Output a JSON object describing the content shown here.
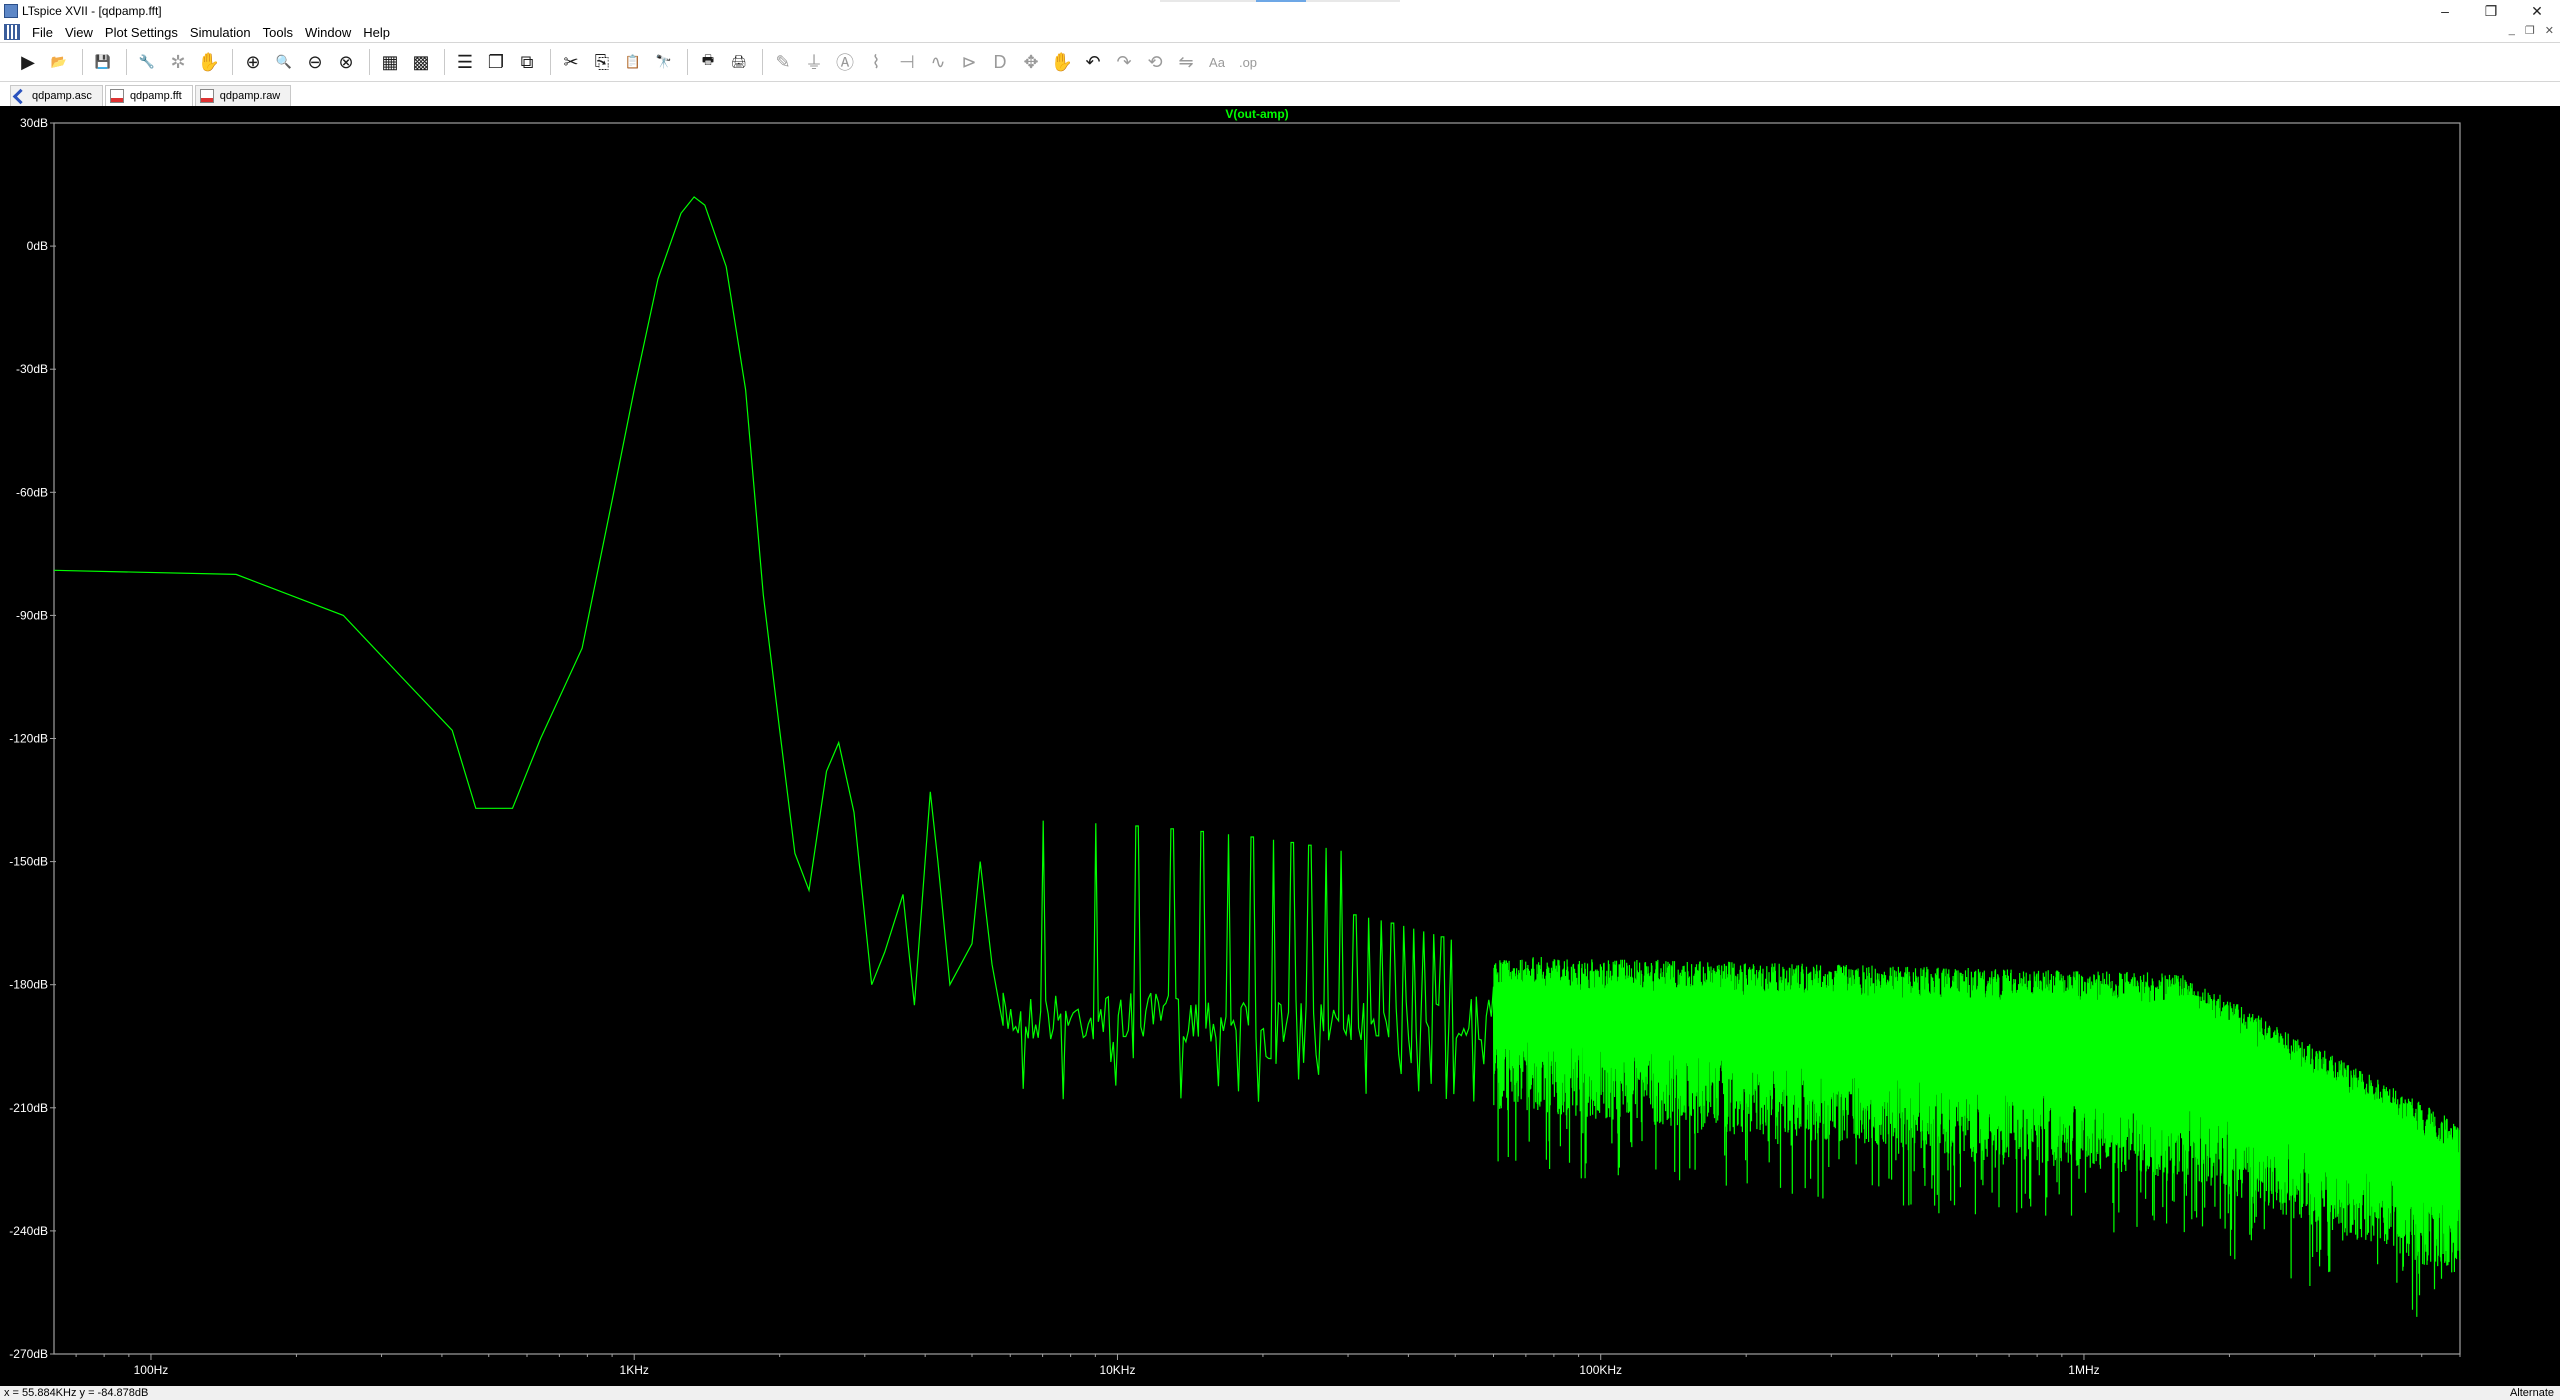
{
  "window": {
    "title": "LTspice XVII - [qdpamp.fft]",
    "controls": {
      "minimize": "–",
      "restore": "❐",
      "close": "✕"
    },
    "mdi_controls": {
      "minimize": "_",
      "restore": "❐",
      "close": "✕"
    }
  },
  "menu": [
    "File",
    "View",
    "Plot Settings",
    "Simulation",
    "Tools",
    "Window",
    "Help"
  ],
  "toolbar": {
    "groups": [
      [
        {
          "icon": "run-icon",
          "glyph": "▶"
        },
        {
          "icon": "open-icon",
          "glyph": "📂"
        }
      ],
      [
        {
          "icon": "save-icon",
          "glyph": "💾"
        }
      ],
      [
        {
          "icon": "control-panel-icon",
          "glyph": "🔧"
        },
        {
          "icon": "halt-icon",
          "glyph": "✲",
          "disabled": true
        },
        {
          "icon": "pan-icon",
          "glyph": "✋",
          "disabled": true
        }
      ],
      [
        {
          "icon": "zoom-in-icon",
          "glyph": "⊕"
        },
        {
          "icon": "zoom-area-icon",
          "glyph": "🔍"
        },
        {
          "icon": "zoom-out-icon",
          "glyph": "⊖"
        },
        {
          "icon": "zoom-fit-icon",
          "glyph": "⊗"
        }
      ],
      [
        {
          "icon": "autorange-icon",
          "glyph": "▦"
        },
        {
          "icon": "grid-icon",
          "glyph": "▩"
        }
      ],
      [
        {
          "icon": "tile-horizontal-icon",
          "glyph": "☰"
        },
        {
          "icon": "cascade-icon",
          "glyph": "❐"
        },
        {
          "icon": "tile-vertical-icon",
          "glyph": "⧉"
        }
      ],
      [
        {
          "icon": "cut-icon",
          "glyph": "✂"
        },
        {
          "icon": "copy-icon",
          "glyph": "⎘"
        },
        {
          "icon": "paste-icon",
          "glyph": "📋"
        },
        {
          "icon": "find-icon",
          "glyph": "🔭"
        }
      ],
      [
        {
          "icon": "print-icon",
          "glyph": "🖶"
        },
        {
          "icon": "print-setup-icon",
          "glyph": "🖨"
        }
      ],
      [
        {
          "icon": "wire-icon",
          "glyph": "✎",
          "disabled": true
        },
        {
          "icon": "ground-icon",
          "glyph": "⏚",
          "disabled": true
        },
        {
          "icon": "label-icon",
          "glyph": "Ⓐ",
          "disabled": true
        },
        {
          "icon": "resistor-icon",
          "glyph": "⌇",
          "disabled": true
        },
        {
          "icon": "capacitor-icon",
          "glyph": "⊣",
          "disabled": true
        },
        {
          "icon": "inductor-icon",
          "glyph": "∿",
          "disabled": true
        },
        {
          "icon": "diode-icon",
          "glyph": "⊳",
          "disabled": true
        },
        {
          "icon": "component-icon",
          "glyph": "D",
          "disabled": true
        },
        {
          "icon": "move-icon",
          "glyph": "✥",
          "disabled": true
        },
        {
          "icon": "drag-icon",
          "glyph": "✋",
          "disabled": true
        },
        {
          "icon": "undo-icon",
          "glyph": "↶"
        },
        {
          "icon": "redo-icon",
          "glyph": "↷",
          "disabled": true
        },
        {
          "icon": "rotate-icon",
          "glyph": "⟲",
          "disabled": true
        },
        {
          "icon": "mirror-icon",
          "glyph": "⇋",
          "disabled": true
        },
        {
          "icon": "text-icon",
          "glyph": "Aa",
          "disabled": true
        },
        {
          "icon": "spice-directive-icon",
          "glyph": ".op",
          "disabled": true
        }
      ]
    ]
  },
  "tabs": [
    {
      "label": "qdpamp.asc",
      "kind": "sch"
    },
    {
      "label": "qdpamp.fft",
      "kind": "wave",
      "active": true
    },
    {
      "label": "qdpamp.raw",
      "kind": "wave"
    }
  ],
  "plot": {
    "trace_name": "V(out-amp)",
    "trace_color": "#00ff00",
    "grid_color": "#a0a0a0",
    "background": "#000000",
    "label_color": "#ffffff"
  },
  "chart_data": {
    "type": "line",
    "title": "V(out-amp)",
    "x_scale": "log",
    "xlim_hz": [
      63,
      6000000
    ],
    "ylim_db": [
      -270,
      30
    ],
    "y_ticks": [
      "30dB",
      "0dB",
      "-30dB",
      "-60dB",
      "-90dB",
      "-120dB",
      "-150dB",
      "-180dB",
      "-210dB",
      "-240dB",
      "-270dB"
    ],
    "x_ticks": [
      "100Hz",
      "1KHz",
      "10KHz",
      "100KHz",
      "1MHz"
    ],
    "series": [
      {
        "name": "V(out-amp)",
        "description_points_hz_db": [
          [
            63,
            -79
          ],
          [
            150,
            -80
          ],
          [
            250,
            -90
          ],
          [
            330,
            -105
          ],
          [
            420,
            -118
          ],
          [
            470,
            -137
          ],
          [
            560,
            -137
          ],
          [
            640,
            -120
          ],
          [
            780,
            -98
          ],
          [
            900,
            -62
          ],
          [
            1000,
            -35
          ],
          [
            1120,
            -8
          ],
          [
            1250,
            8
          ],
          [
            1330,
            12
          ],
          [
            1400,
            10
          ],
          [
            1550,
            -5
          ],
          [
            1700,
            -35
          ],
          [
            1850,
            -85
          ],
          [
            2000,
            -118
          ],
          [
            2150,
            -148
          ],
          [
            2300,
            -157
          ],
          [
            2500,
            -128
          ],
          [
            2650,
            -121
          ],
          [
            2850,
            -138
          ],
          [
            3100,
            -180
          ],
          [
            3300,
            -172
          ],
          [
            3600,
            -158
          ],
          [
            3800,
            -185
          ],
          [
            4100,
            -133
          ],
          [
            4250,
            -150
          ],
          [
            4500,
            -180
          ],
          [
            5000,
            -170
          ],
          [
            5200,
            -150
          ],
          [
            5500,
            -175
          ],
          [
            5800,
            -190
          ]
        ]
      }
    ]
  },
  "status": {
    "cursor_readout": "x = 55.884KHz   y = -84.878dB",
    "mode": "Alternate"
  }
}
